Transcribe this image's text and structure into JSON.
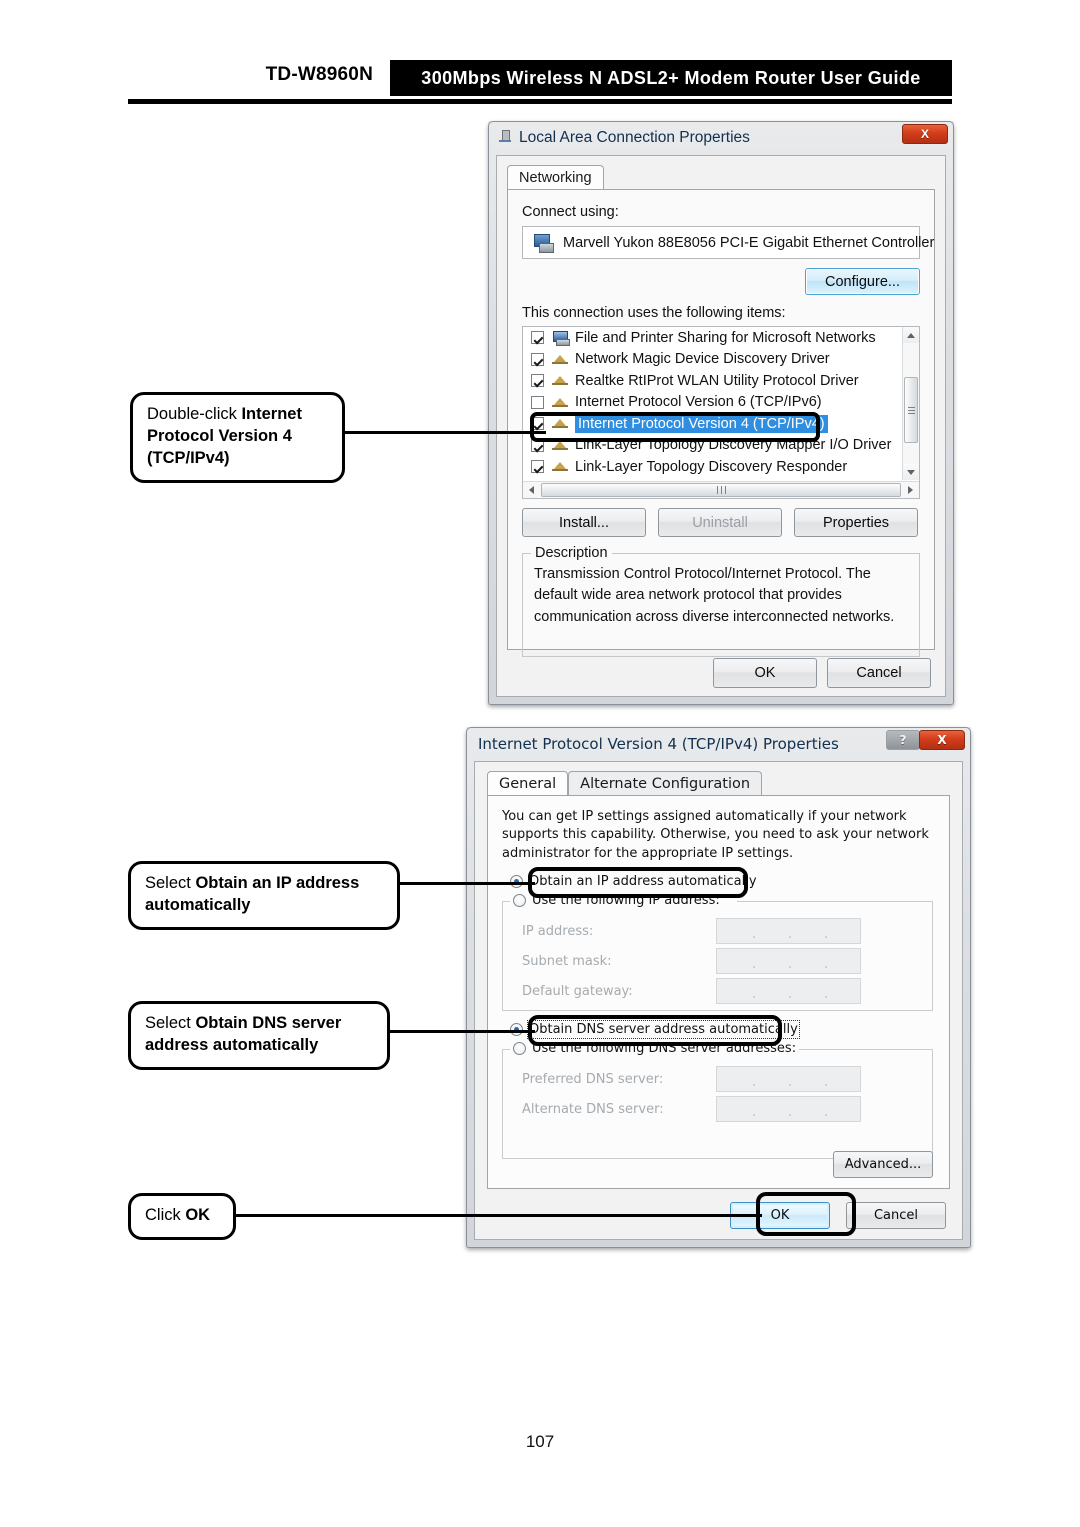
{
  "header": {
    "model": "TD-W8960N",
    "band": "300Mbps  Wireless  N  ADSL2+  Modem  Router  User  Guide"
  },
  "page_number": "107",
  "callouts": [
    {
      "id": "callout-ipv4",
      "prefix": "Double-click ",
      "bold": "Internet Protocol Version 4 (TCP/IPv4)"
    },
    {
      "id": "callout-obtain-ip",
      "prefix": "Select ",
      "bold": "Obtain an IP address automatically"
    },
    {
      "id": "callout-obtain-dns",
      "prefix": "Select ",
      "bold": "Obtain DNS server address automatically"
    },
    {
      "id": "callout-click-ok",
      "prefix": "Click ",
      "bold": "OK"
    }
  ],
  "dialog1": {
    "title": "Local Area Connection Properties",
    "close_label": "X",
    "tab": "Networking",
    "connect_using_label": "Connect using:",
    "adapter": "Marvell Yukon 88E8056 PCI-E Gigabit Ethernet Controller",
    "configure_button": "Configure...",
    "items_label": "This connection uses the following items:",
    "items": [
      {
        "label": "File and Printer Sharing for Microsoft Networks",
        "checked": true,
        "selected": false,
        "icon": "share-icon"
      },
      {
        "label": "Network Magic Device Discovery Driver",
        "checked": true,
        "selected": false,
        "icon": "protocol-icon"
      },
      {
        "label": "Realtke RtIProt WLAN Utility Protocol Driver",
        "checked": true,
        "selected": false,
        "icon": "protocol-icon"
      },
      {
        "label": "Internet Protocol Version 6 (TCP/IPv6)",
        "checked": false,
        "selected": false,
        "icon": "protocol-icon"
      },
      {
        "label": "Internet Protocol Version 4 (TCP/IPv4)",
        "checked": true,
        "selected": true,
        "icon": "protocol-icon"
      },
      {
        "label": "Link-Layer Topology Discovery Mapper I/O Driver",
        "checked": true,
        "selected": false,
        "icon": "protocol-icon"
      },
      {
        "label": "Link-Layer Topology Discovery Responder",
        "checked": true,
        "selected": false,
        "icon": "protocol-icon"
      }
    ],
    "install_button": "Install...",
    "uninstall_button": "Uninstall",
    "properties_button": "Properties",
    "description_title": "Description",
    "description_text": "Transmission Control Protocol/Internet Protocol. The default wide area network protocol that provides communication across diverse interconnected networks.",
    "ok_button": "OK",
    "cancel_button": "Cancel"
  },
  "dialog2": {
    "title": "Internet Protocol Version 4 (TCP/IPv4) Properties",
    "help_label": "?",
    "close_label": "X",
    "tab_general": "General",
    "tab_alternate": "Alternate Configuration",
    "intro": "You can get IP settings assigned automatically if your network supports this capability. Otherwise, you need to ask your network administrator for the appropriate IP settings.",
    "radio_obtain_ip": "Obtain an IP address automatically",
    "radio_use_ip": "Use the following IP address:",
    "label_ip_address": "IP address:",
    "label_subnet_mask": "Subnet mask:",
    "label_default_gateway": "Default gateway:",
    "radio_obtain_dns": "Obtain DNS server address automatically",
    "radio_use_dns": "Use the following DNS server addresses:",
    "label_preferred_dns": "Preferred DNS server:",
    "label_alternate_dns": "Alternate DNS server:",
    "advanced_button": "Advanced...",
    "ok_button": "OK",
    "cancel_button": "Cancel",
    "field_values": {
      "ip_address": "",
      "subnet_mask": "",
      "default_gateway": "",
      "preferred_dns": "",
      "alternate_dns": ""
    }
  },
  "colors": {
    "selection_blue": "#2f8ee0",
    "close_red": "#d23d19",
    "default_button_blue": "#3c8fc4",
    "callout_black": "#000000"
  }
}
